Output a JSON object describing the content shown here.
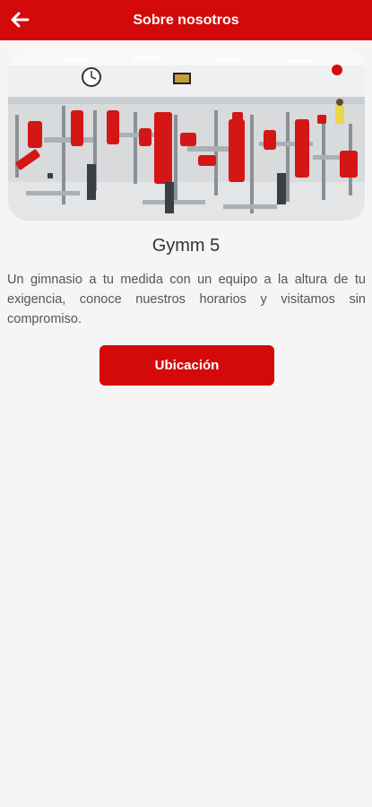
{
  "header": {
    "title": "Sobre nosotros",
    "back_icon": "arrow-left-icon",
    "background": "#d40a0a"
  },
  "hero": {
    "alt": "Gym photo with red exercise machines"
  },
  "content": {
    "name": "Gymm 5",
    "description": "Un gimnasio a tu medida con un equipo a la altura de tu exigencia, conoce nuestros horarios y visitamos sin compromiso.",
    "button_label": "Ubicación"
  },
  "colors": {
    "accent": "#d40a0a",
    "background": "#f5f5f5"
  }
}
